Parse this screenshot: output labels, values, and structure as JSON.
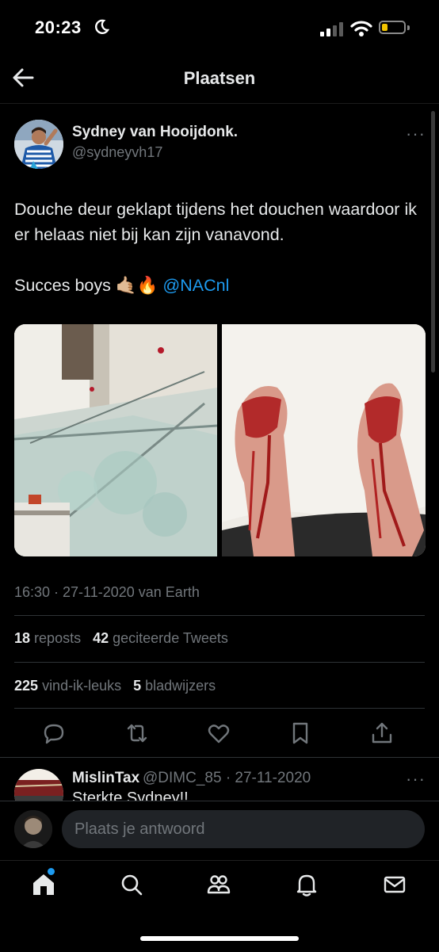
{
  "status_bar": {
    "time": "20:23"
  },
  "header": {
    "title": "Plaatsen"
  },
  "tweet": {
    "author_name": "Sydney van Hooijdonk.",
    "author_handle": "@sydneyvh17",
    "more_label": "···",
    "text_line1": "Douche deur geklapt tijdens het douchen waardoor ik er helaas niet bij kan zijn vanavond.",
    "text_line2_prefix": "Succes boys",
    "text_emojis": "🤙🏼🔥",
    "mention": "@NACnl",
    "timestamp": "16:30 · 27-11-2020 van Earth",
    "reposts_count": "18",
    "reposts_label": "reposts",
    "quotes_count": "42",
    "quotes_label": "geciteerde Tweets",
    "likes_count": "225",
    "likes_label": "vind-ik-leuks",
    "bookmarks_count": "5",
    "bookmarks_label": "bladwijzers"
  },
  "reply": {
    "author_name": "MislinTax",
    "author_handle_date": "@DIMC_85 · 27-11-2020",
    "text": "Sterkte Sydney!!",
    "more_label": "···"
  },
  "composer": {
    "placeholder": "Plaats je antwoord"
  },
  "colors": {
    "accent": "#1d9bf0",
    "muted": "#71767b",
    "text": "#e7e9ea",
    "battery": "#f2c400"
  }
}
